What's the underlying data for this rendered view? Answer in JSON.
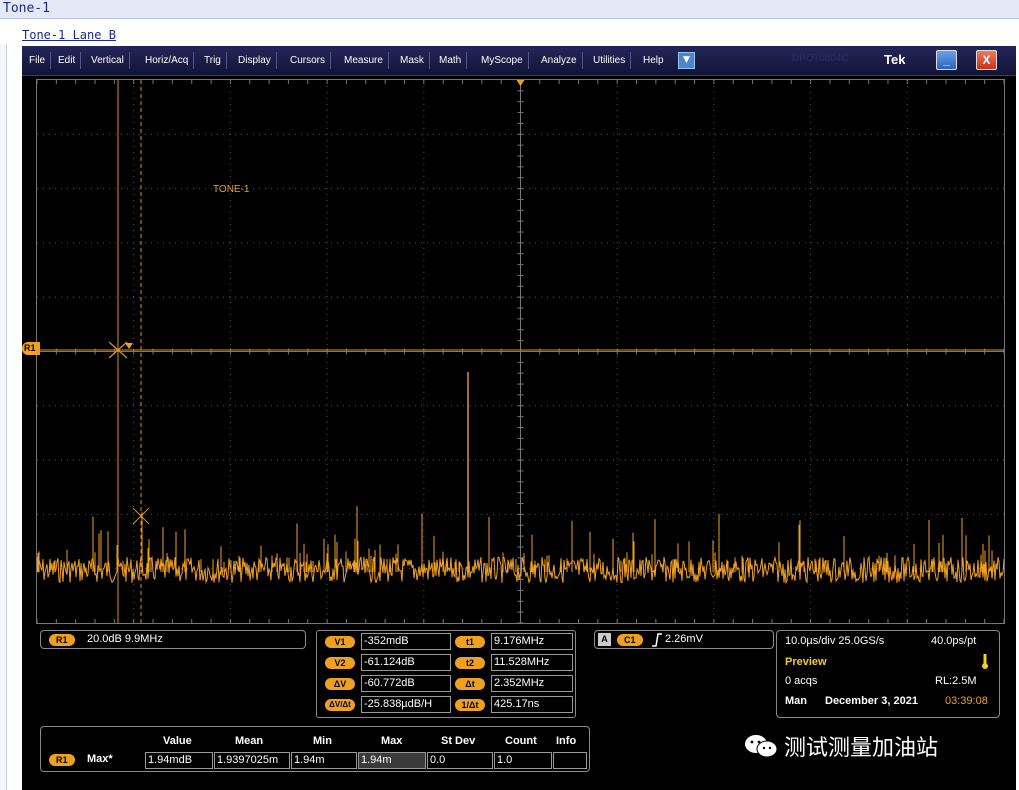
{
  "window": {
    "title": "Tone-1",
    "lane_link": "Tone-1 Lane B"
  },
  "menu": [
    "File",
    "Edit",
    "Vertical",
    "Horiz/Acq",
    "Trig",
    "Display",
    "Cursors",
    "Measure",
    "Mask",
    "Math",
    "MyScope",
    "Analyze",
    "Utilities",
    "Help"
  ],
  "brand": "Tek",
  "faint_model": "DPO70804C",
  "waveform": {
    "label": "TONE-1",
    "ref_marker": "R1",
    "color": "#f0a020",
    "cursor_color": "#d8901a"
  },
  "ref_info": {
    "badge": "R1",
    "text": "20.0dB  9.9MHz"
  },
  "cursors": {
    "v1_label": "V1",
    "v1": "-352mdB",
    "v2_label": "V2",
    "v2": "-61.124dB",
    "dv_label": "ΔV",
    "dv": "-60.772dB",
    "dvdt_label": "ΔV/Δt",
    "dvdt": "-25.838µdB/H",
    "t1_label": "t1",
    "t1": "9.176MHz",
    "t2_label": "t2",
    "t2": "11.528MHz",
    "dt_label": "Δt",
    "dt": "2.352MHz",
    "inv_label": "1/Δt",
    "inv": "425.17ns"
  },
  "trigger": {
    "a_badge": "A",
    "ch_badge": "C1",
    "level": "2.26mV"
  },
  "acq": {
    "timebase": "10.0µs/div  25.0GS/s",
    "pt": "40.0ps/pt",
    "mode": "Preview",
    "acqs": "0 acqs",
    "rl": "RL:2.5M",
    "man": "Man",
    "date": "December 3, 2021",
    "time": "03:39:08"
  },
  "measure": {
    "headers": [
      "Value",
      "Mean",
      "Min",
      "Max",
      "St Dev",
      "Count",
      "Info"
    ],
    "badge": "R1",
    "name": "Max*",
    "values": [
      "1.94mdB",
      "1.9397025m",
      "1.94m",
      "1.94m",
      "0.0",
      "1.0",
      ""
    ]
  },
  "watermark": "测试测量加油站"
}
